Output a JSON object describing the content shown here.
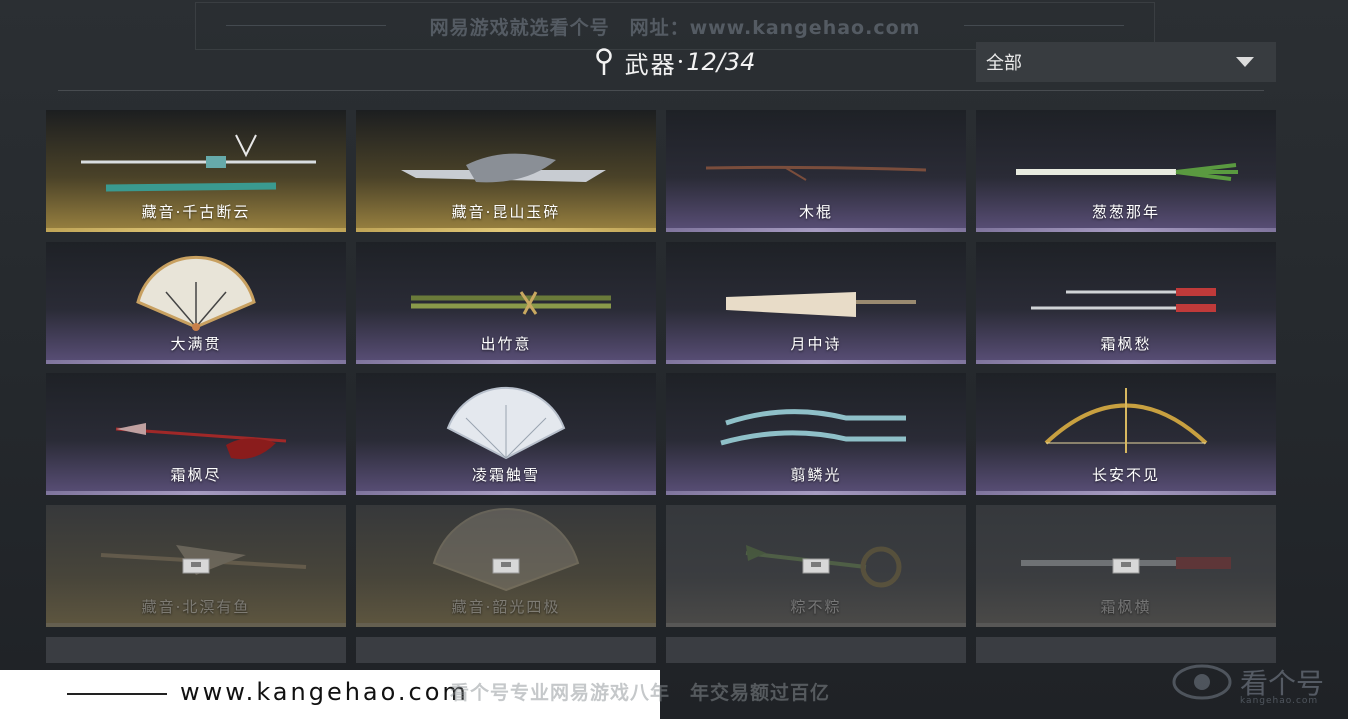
{
  "watermark": {
    "top": "网易游戏就选看个号　网址：www.kangehao.com",
    "bottom_url": "www.kangehao.com",
    "bottom_text": "看个号专业网易游戏八年　年交易额过百亿",
    "logo_text": "看个号",
    "logo_sub": "kangehao.com"
  },
  "header": {
    "title": "武器",
    "separator": "·",
    "count": "12/34"
  },
  "filter": {
    "selected": "全部"
  },
  "colors": {
    "rare_card": "#9a8240",
    "normal_card": "#5a4f78",
    "locked_card": "#4b4a48"
  },
  "weapons": [
    {
      "name": "藏音·千古断云",
      "rarity": "gold",
      "unlocked": true,
      "icon": "sword-and-scabbard-icon"
    },
    {
      "name": "藏音·昆山玉碎",
      "rarity": "gold",
      "unlocked": true,
      "icon": "ornate-blade-icon"
    },
    {
      "name": "木棍",
      "rarity": "normal",
      "unlocked": true,
      "icon": "wooden-stick-icon"
    },
    {
      "name": "葱葱那年",
      "rarity": "normal",
      "unlocked": true,
      "icon": "scallion-icon"
    },
    {
      "name": "大满贯",
      "rarity": "normal",
      "unlocked": true,
      "icon": "folding-fan-icon"
    },
    {
      "name": "出竹意",
      "rarity": "normal",
      "unlocked": true,
      "icon": "bamboo-staff-icon"
    },
    {
      "name": "月中诗",
      "rarity": "normal",
      "unlocked": true,
      "icon": "umbrella-icon"
    },
    {
      "name": "霜枫愁",
      "rarity": "normal",
      "unlocked": true,
      "icon": "twin-blades-icon"
    },
    {
      "name": "霜枫尽",
      "rarity": "normal",
      "unlocked": true,
      "icon": "spear-icon"
    },
    {
      "name": "凌霜触雪",
      "rarity": "normal",
      "unlocked": true,
      "icon": "lace-fan-icon"
    },
    {
      "name": "翦鳞光",
      "rarity": "normal",
      "unlocked": true,
      "icon": "dual-curved-blades-icon"
    },
    {
      "name": "长安不见",
      "rarity": "normal",
      "unlocked": true,
      "icon": "golden-bow-icon"
    },
    {
      "name": "藏音·北溟有鱼",
      "rarity": "gold",
      "unlocked": false,
      "icon": "long-spear-icon"
    },
    {
      "name": "藏音·韶光四极",
      "rarity": "gold",
      "unlocked": false,
      "icon": "grand-fan-icon"
    },
    {
      "name": "粽不粽",
      "rarity": "normal",
      "unlocked": false,
      "icon": "zongzi-staff-icon"
    },
    {
      "name": "霜枫横",
      "rarity": "normal",
      "unlocked": false,
      "icon": "broad-blade-icon"
    }
  ]
}
